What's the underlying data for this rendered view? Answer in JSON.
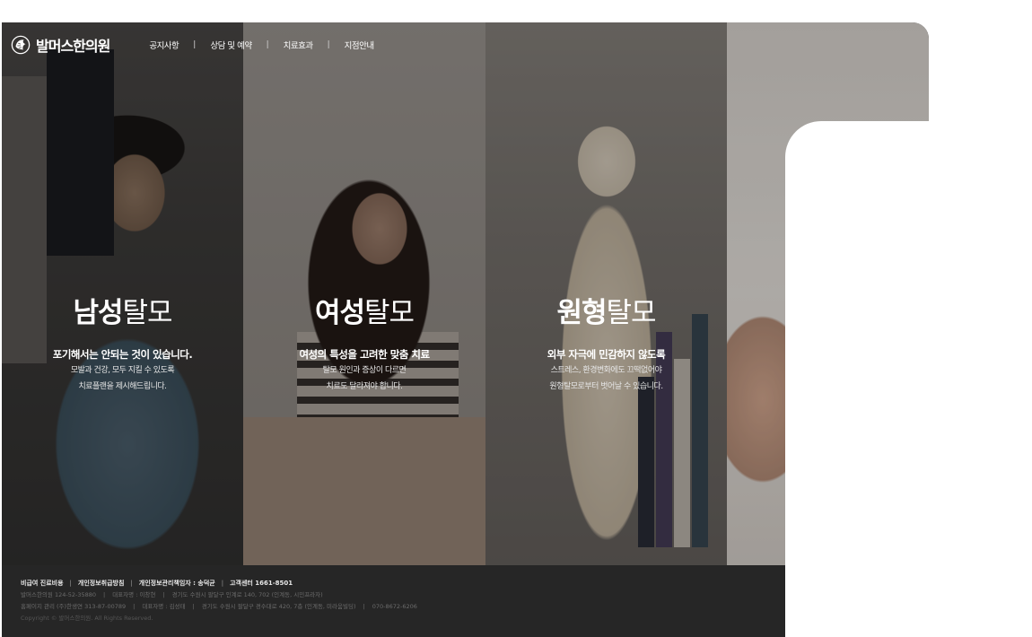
{
  "brand": {
    "name": "발머스한의원"
  },
  "nav": [
    "공지사항",
    "상담 및 예약",
    "치료효과",
    "지점안내"
  ],
  "panels": [
    {
      "title_bold": "남성",
      "title_light": "탈모",
      "desc1": "포기해서는 안되는 것이 있습니다.",
      "desc2": "모발과 건강, 모두 지킬 수 있도록",
      "desc3": "치료플랜을 제시해드립니다."
    },
    {
      "title_bold": "여성",
      "title_light": "탈모",
      "desc1": "여성의 특성을 고려한 맞춤 치료",
      "desc2": "탈모 원인과 증상이 다르면",
      "desc3": "치료도 달라져야 합니다."
    },
    {
      "title_bold": "원형",
      "title_light": "탈모",
      "desc1": "외부 자극에 민감하지 않도록",
      "desc2": "스트레스, 환경변화에도 끄떡없어야",
      "desc3": "원형탈모로부터 벗어날 수 있습니다."
    }
  ],
  "footer": {
    "links": [
      "비급여 진료비용",
      "개인정보취급방침",
      "개인정보관리책임자 : 송덕균",
      "고객센터 1661-8501"
    ],
    "line1": [
      "발머스한의원 124-52-35880",
      "대표자명 : 이창현",
      "경기도 수원시 팔달구 인계로 140, 702 (인계동, 시민프라자)"
    ],
    "line2": [
      "홈페이지 관리 (주)한생연 313-87-00789",
      "대표자명 : 김성태",
      "경기도 수원시 팔달구 경수대로 420, 7층 (인계동, 미라움빌딩)",
      "070-8672-6206"
    ],
    "copyright": "Copyright © 발머스한의원. All Rights Reserved."
  }
}
